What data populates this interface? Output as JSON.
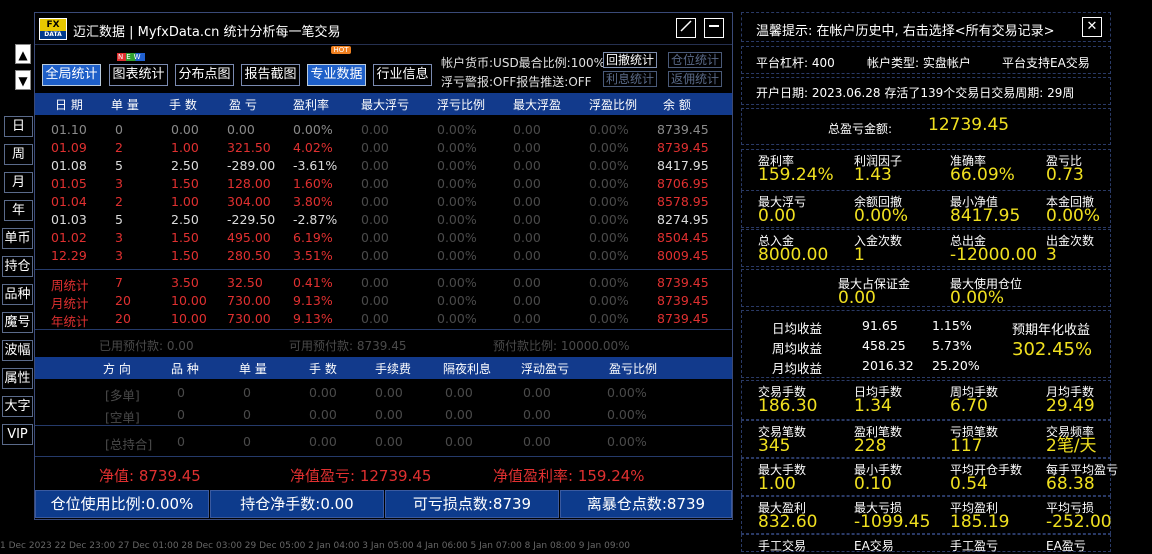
{
  "left_panel": {
    "arrow_up": "▲",
    "arrow_down": "▼",
    "buttons": [
      "日",
      "周",
      "月",
      "年",
      "单币",
      "持仓",
      "品种",
      "魔号",
      "波幅",
      "属性",
      "大字",
      "VIP"
    ]
  },
  "window": {
    "logo_top": "FX",
    "logo_bottom": "DATA",
    "title": "迈汇数据 | MyfxData.cn  统计分析每一笔交易",
    "tabs": [
      "全局统计",
      "图表统计",
      "分布点图",
      "报告截图",
      "专业数据",
      "行业信息"
    ],
    "new_badge": "NEW",
    "hot_badge": "HOT",
    "account_currency": "帐户货币:USD最合比例:100%",
    "float_alert": "浮亏警报:OFF报告推送:OFF",
    "btn_withdraw": "回撤统计",
    "btn_position": "仓位统计",
    "btn_profit": "利息统计",
    "btn_return": "返佣统计"
  },
  "table": {
    "headers": [
      "日 期",
      "单 量",
      "手 数",
      "盈 亏",
      "盈利率",
      "最大浮亏",
      "浮亏比例",
      "最大浮盈",
      "浮盈比例",
      "余 额"
    ],
    "rows": [
      [
        "01.10",
        "0",
        "0.00",
        "0.00",
        "0.00%",
        "0.00",
        "0.00%",
        "0.00",
        "0.00%",
        "8739.45"
      ],
      [
        "01.09",
        "2",
        "1.00",
        "321.50",
        "4.02%",
        "0.00",
        "0.00%",
        "0.00",
        "0.00%",
        "8739.45"
      ],
      [
        "01.08",
        "5",
        "2.50",
        "-289.00",
        "-3.61%",
        "0.00",
        "0.00%",
        "0.00",
        "0.00%",
        "8417.95"
      ],
      [
        "01.05",
        "3",
        "1.50",
        "128.00",
        "1.60%",
        "0.00",
        "0.00%",
        "0.00",
        "0.00%",
        "8706.95"
      ],
      [
        "01.04",
        "2",
        "1.00",
        "304.00",
        "3.80%",
        "0.00",
        "0.00%",
        "0.00",
        "0.00%",
        "8578.95"
      ],
      [
        "01.03",
        "5",
        "2.50",
        "-229.50",
        "-2.87%",
        "0.00",
        "0.00%",
        "0.00",
        "0.00%",
        "8274.95"
      ],
      [
        "01.02",
        "3",
        "1.50",
        "495.00",
        "6.19%",
        "0.00",
        "0.00%",
        "0.00",
        "0.00%",
        "8504.45"
      ],
      [
        "12.29",
        "3",
        "1.50",
        "280.50",
        "3.51%",
        "0.00",
        "0.00%",
        "0.00",
        "0.00%",
        "8009.45"
      ]
    ],
    "summary": [
      [
        "周统计",
        "7",
        "3.50",
        "32.50",
        "0.41%",
        "0.00",
        "0.00%",
        "0.00",
        "0.00%",
        "8739.45"
      ],
      [
        "月统计",
        "20",
        "10.00",
        "730.00",
        "9.13%",
        "0.00",
        "0.00%",
        "0.00",
        "0.00%",
        "8739.45"
      ],
      [
        "年统计",
        "20",
        "10.00",
        "730.00",
        "9.13%",
        "0.00",
        "0.00%",
        "0.00",
        "0.00%",
        "8739.45"
      ]
    ],
    "prepay": [
      "已用预付款: 0.00",
      "可用预付款: 8739.45",
      "预付款比例: 10000.00%"
    ]
  },
  "positions": {
    "headers": [
      "方 向",
      "品 种",
      "单 量",
      "手 数",
      "手续费",
      "隔夜利息",
      "浮动盈亏",
      "盈亏比例"
    ],
    "rows": [
      [
        "[多单]",
        "0",
        "0",
        "0.00",
        "0.00",
        "0.00",
        "0.00",
        "0.00%"
      ],
      [
        "[空单]",
        "0",
        "0",
        "0.00",
        "0.00",
        "0.00",
        "0.00",
        "0.00%"
      ],
      [
        "[总持合]",
        "0",
        "0",
        "0.00",
        "0.00",
        "0.00",
        "0.00",
        "0.00%"
      ]
    ]
  },
  "net": {
    "equity": "净值: 8739.45",
    "equity_profit": "净值盈亏: 12739.45",
    "equity_rate": "净值盈利率: 159.24%"
  },
  "bottom": [
    "仓位使用比例:0.00%",
    "持仓净手数:0.00",
    "可亏损点数:8739",
    "离暴仓点数:8739"
  ],
  "right": {
    "tip": "温馨提示: 在帐户历史中, 右击选择<所有交易记录>",
    "close": "✕",
    "leverage": "平台杠杆: 400",
    "account_type": "帐户类型: 实盘帐户",
    "ea": "平台支持EA交易",
    "open_date": "开户日期: 2023.06.28 存活了139个交易日交易周期: 29周",
    "total_profit_label": "总盈亏金额:",
    "total_profit": "12739.45",
    "g1": [
      [
        "盈利率",
        "159.24%"
      ],
      [
        "利润因子",
        "1.43"
      ],
      [
        "准确率",
        "66.09%"
      ],
      [
        "盈亏比",
        "0.73"
      ]
    ],
    "g2": [
      [
        "最大浮亏",
        "0.00"
      ],
      [
        "余额回撤",
        "0.00%"
      ],
      [
        "最小净值",
        "8417.95"
      ],
      [
        "本金回撤",
        "0.00%"
      ]
    ],
    "g3": [
      [
        "总入金",
        "8000.00"
      ],
      [
        "入金次数",
        "1"
      ],
      [
        "总出金",
        "-12000.00"
      ],
      [
        "出金次数",
        "3"
      ]
    ],
    "g4": [
      [
        "最大占保证金",
        "0.00"
      ],
      [
        "最大使用仓位",
        "0.00%"
      ]
    ],
    "avg": [
      [
        "日均收益",
        "91.65",
        "1.15%"
      ],
      [
        "周均收益",
        "458.25",
        "5.73%"
      ],
      [
        "月均收益",
        "2016.32",
        "25.20%"
      ]
    ],
    "annual_label": "预期年化收益",
    "annual": "302.45%",
    "g5": [
      [
        "交易手数",
        "186.30"
      ],
      [
        "日均手数",
        "1.34"
      ],
      [
        "周均手数",
        "6.70"
      ],
      [
        "月均手数",
        "29.49"
      ]
    ],
    "g6": [
      [
        "交易笔数",
        "345"
      ],
      [
        "盈利笔数",
        "228"
      ],
      [
        "亏损笔数",
        "117"
      ],
      [
        "交易频率",
        "2笔/天"
      ]
    ],
    "g7": [
      [
        "最大手数",
        "1.00"
      ],
      [
        "最小手数",
        "0.10"
      ],
      [
        "平均开仓手数",
        "0.54"
      ],
      [
        "每手平均盈亏",
        "68.38"
      ]
    ],
    "g8": [
      [
        "最大盈利",
        "832.60"
      ],
      [
        "最大亏损",
        "-1099.45"
      ],
      [
        "平均盈利",
        "185.19"
      ],
      [
        "平均亏损",
        "-252.00"
      ]
    ],
    "g9": [
      "手工交易",
      "EA交易",
      "手工盈亏",
      "EA盈亏"
    ]
  },
  "ruler": "1 Dec 2023    22 Dec 23:00    27 Dec 01:00    28 Dec 03:00    29 Dec 05:00    2 Jan 04:00    3 Jan 05:00    4 Jan 06:00    5 Jan 07:00    8 Jan 08:00    9 Jan 09:00"
}
